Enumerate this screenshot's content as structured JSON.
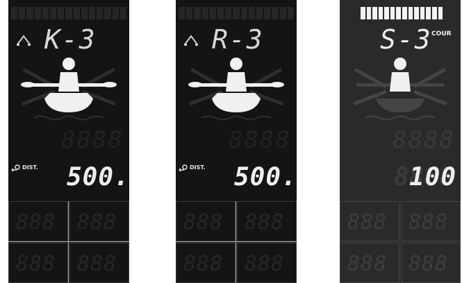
{
  "panels": [
    {
      "mode_code": "K-3",
      "header_icon": "paddles-crossed-icon",
      "distance_label": "DIST.",
      "distance_value": "500.",
      "grid_ghost": [
        "888",
        "888",
        "888",
        "888"
      ]
    },
    {
      "mode_code": "R-3",
      "header_icon": "paddles-crossed-icon",
      "distance_label": "DIST.",
      "distance_value": "500.",
      "grid_ghost": [
        "888",
        "888",
        "888",
        "888"
      ]
    },
    {
      "mode_code": "S-3",
      "sync_label": "COUR",
      "distance_value": "100",
      "grid_ghost": [
        "888",
        "888",
        "888",
        "888"
      ]
    }
  ],
  "ghost": {
    "mid_digits": "8888",
    "distance_digits": "8888"
  },
  "colors": {
    "panel_bg": "#141414",
    "panel3_bg": "#2a2a2a",
    "segment_lit": "#eeeeee",
    "grid_line": "#b0b0b0"
  }
}
